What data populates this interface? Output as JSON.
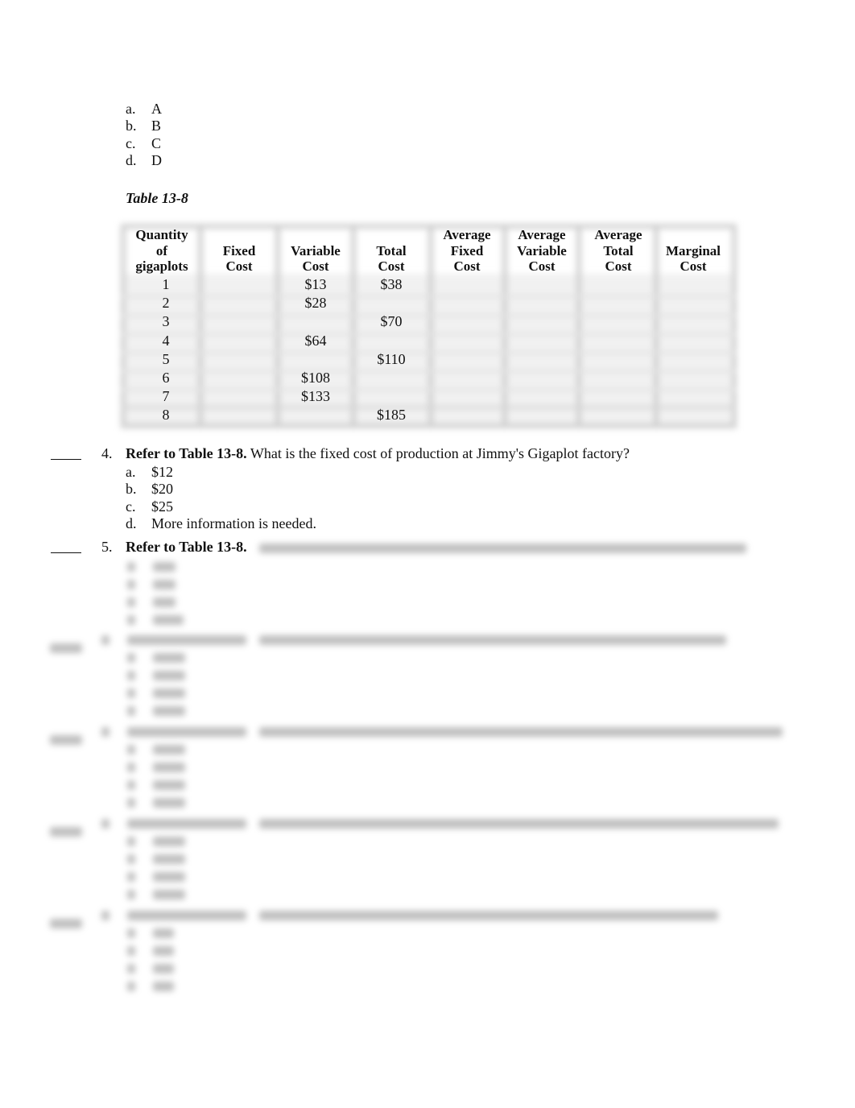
{
  "prev_question_options": [
    {
      "letter": "a.",
      "text": "A"
    },
    {
      "letter": "b.",
      "text": "B"
    },
    {
      "letter": "c.",
      "text": "C"
    },
    {
      "letter": "d.",
      "text": "D"
    }
  ],
  "table": {
    "title": "Table 13-8",
    "headers": [
      [
        "Quantity",
        "of",
        "gigaplots"
      ],
      [
        "",
        "Fixed",
        "Cost"
      ],
      [
        "",
        "Variable",
        "Cost"
      ],
      [
        "",
        "Total",
        "Cost"
      ],
      [
        "Average",
        "Fixed",
        "Cost"
      ],
      [
        "Average",
        "Variable",
        "Cost"
      ],
      [
        "Average",
        "Total",
        "Cost"
      ],
      [
        "",
        "Marginal",
        "Cost"
      ]
    ],
    "rows": [
      [
        "1",
        "",
        "$13",
        "$38",
        "",
        "",
        "",
        ""
      ],
      [
        "2",
        "",
        "$28",
        "",
        "",
        "",
        "",
        ""
      ],
      [
        "3",
        "",
        "",
        "$70",
        "",
        "",
        "",
        ""
      ],
      [
        "4",
        "",
        "$64",
        "",
        "",
        "",
        "",
        ""
      ],
      [
        "5",
        "",
        "",
        "$110",
        "",
        "",
        "",
        ""
      ],
      [
        "6",
        "",
        "$108",
        "",
        "",
        "",
        "",
        ""
      ],
      [
        "7",
        "",
        "$133",
        "",
        "",
        "",
        "",
        ""
      ],
      [
        "8",
        "",
        "",
        "$185",
        "",
        "",
        "",
        ""
      ]
    ]
  },
  "questions": [
    {
      "number": "4.",
      "lead": "Refer to Table 13-8.",
      "text": "What is the fixed cost of production at Jimmy's Gigaplot factory?",
      "options": [
        {
          "letter": "a.",
          "text": "$12"
        },
        {
          "letter": "b.",
          "text": "$20"
        },
        {
          "letter": "c.",
          "text": "$25"
        },
        {
          "letter": "d.",
          "text": "More information is needed."
        }
      ]
    },
    {
      "number": "5.",
      "lead": "Refer to Table 13-8.",
      "text": ""
    }
  ],
  "blurred_note": "Remaining content is obscured"
}
